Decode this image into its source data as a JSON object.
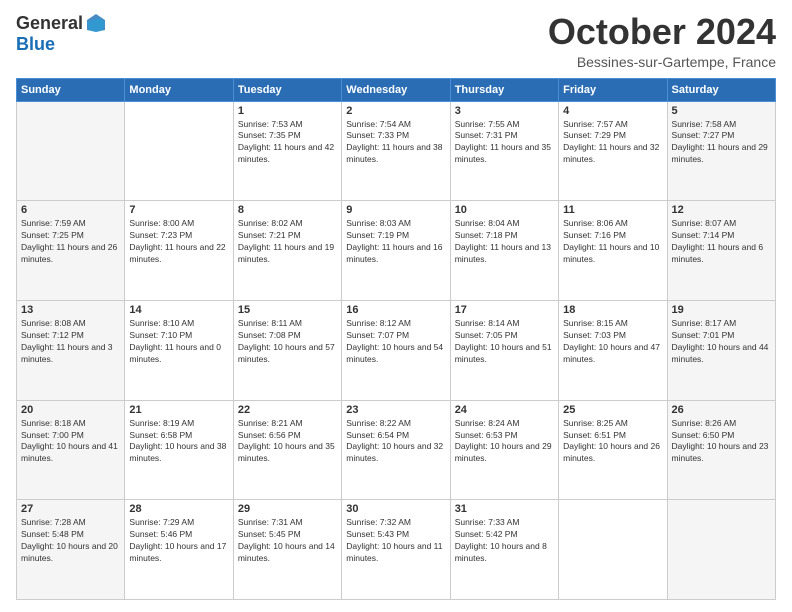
{
  "header": {
    "logo_general": "General",
    "logo_blue": "Blue",
    "month": "October 2024",
    "location": "Bessines-sur-Gartempe, France"
  },
  "weekdays": [
    "Sunday",
    "Monday",
    "Tuesday",
    "Wednesday",
    "Thursday",
    "Friday",
    "Saturday"
  ],
  "weeks": [
    [
      {
        "day": "",
        "info": ""
      },
      {
        "day": "",
        "info": ""
      },
      {
        "day": "1",
        "info": "Sunrise: 7:53 AM\nSunset: 7:35 PM\nDaylight: 11 hours and 42 minutes."
      },
      {
        "day": "2",
        "info": "Sunrise: 7:54 AM\nSunset: 7:33 PM\nDaylight: 11 hours and 38 minutes."
      },
      {
        "day": "3",
        "info": "Sunrise: 7:55 AM\nSunset: 7:31 PM\nDaylight: 11 hours and 35 minutes."
      },
      {
        "day": "4",
        "info": "Sunrise: 7:57 AM\nSunset: 7:29 PM\nDaylight: 11 hours and 32 minutes."
      },
      {
        "day": "5",
        "info": "Sunrise: 7:58 AM\nSunset: 7:27 PM\nDaylight: 11 hours and 29 minutes."
      }
    ],
    [
      {
        "day": "6",
        "info": "Sunrise: 7:59 AM\nSunset: 7:25 PM\nDaylight: 11 hours and 26 minutes."
      },
      {
        "day": "7",
        "info": "Sunrise: 8:00 AM\nSunset: 7:23 PM\nDaylight: 11 hours and 22 minutes."
      },
      {
        "day": "8",
        "info": "Sunrise: 8:02 AM\nSunset: 7:21 PM\nDaylight: 11 hours and 19 minutes."
      },
      {
        "day": "9",
        "info": "Sunrise: 8:03 AM\nSunset: 7:19 PM\nDaylight: 11 hours and 16 minutes."
      },
      {
        "day": "10",
        "info": "Sunrise: 8:04 AM\nSunset: 7:18 PM\nDaylight: 11 hours and 13 minutes."
      },
      {
        "day": "11",
        "info": "Sunrise: 8:06 AM\nSunset: 7:16 PM\nDaylight: 11 hours and 10 minutes."
      },
      {
        "day": "12",
        "info": "Sunrise: 8:07 AM\nSunset: 7:14 PM\nDaylight: 11 hours and 6 minutes."
      }
    ],
    [
      {
        "day": "13",
        "info": "Sunrise: 8:08 AM\nSunset: 7:12 PM\nDaylight: 11 hours and 3 minutes."
      },
      {
        "day": "14",
        "info": "Sunrise: 8:10 AM\nSunset: 7:10 PM\nDaylight: 11 hours and 0 minutes."
      },
      {
        "day": "15",
        "info": "Sunrise: 8:11 AM\nSunset: 7:08 PM\nDaylight: 10 hours and 57 minutes."
      },
      {
        "day": "16",
        "info": "Sunrise: 8:12 AM\nSunset: 7:07 PM\nDaylight: 10 hours and 54 minutes."
      },
      {
        "day": "17",
        "info": "Sunrise: 8:14 AM\nSunset: 7:05 PM\nDaylight: 10 hours and 51 minutes."
      },
      {
        "day": "18",
        "info": "Sunrise: 8:15 AM\nSunset: 7:03 PM\nDaylight: 10 hours and 47 minutes."
      },
      {
        "day": "19",
        "info": "Sunrise: 8:17 AM\nSunset: 7:01 PM\nDaylight: 10 hours and 44 minutes."
      }
    ],
    [
      {
        "day": "20",
        "info": "Sunrise: 8:18 AM\nSunset: 7:00 PM\nDaylight: 10 hours and 41 minutes."
      },
      {
        "day": "21",
        "info": "Sunrise: 8:19 AM\nSunset: 6:58 PM\nDaylight: 10 hours and 38 minutes."
      },
      {
        "day": "22",
        "info": "Sunrise: 8:21 AM\nSunset: 6:56 PM\nDaylight: 10 hours and 35 minutes."
      },
      {
        "day": "23",
        "info": "Sunrise: 8:22 AM\nSunset: 6:54 PM\nDaylight: 10 hours and 32 minutes."
      },
      {
        "day": "24",
        "info": "Sunrise: 8:24 AM\nSunset: 6:53 PM\nDaylight: 10 hours and 29 minutes."
      },
      {
        "day": "25",
        "info": "Sunrise: 8:25 AM\nSunset: 6:51 PM\nDaylight: 10 hours and 26 minutes."
      },
      {
        "day": "26",
        "info": "Sunrise: 8:26 AM\nSunset: 6:50 PM\nDaylight: 10 hours and 23 minutes."
      }
    ],
    [
      {
        "day": "27",
        "info": "Sunrise: 7:28 AM\nSunset: 5:48 PM\nDaylight: 10 hours and 20 minutes."
      },
      {
        "day": "28",
        "info": "Sunrise: 7:29 AM\nSunset: 5:46 PM\nDaylight: 10 hours and 17 minutes."
      },
      {
        "day": "29",
        "info": "Sunrise: 7:31 AM\nSunset: 5:45 PM\nDaylight: 10 hours and 14 minutes."
      },
      {
        "day": "30",
        "info": "Sunrise: 7:32 AM\nSunset: 5:43 PM\nDaylight: 10 hours and 11 minutes."
      },
      {
        "day": "31",
        "info": "Sunrise: 7:33 AM\nSunset: 5:42 PM\nDaylight: 10 hours and 8 minutes."
      },
      {
        "day": "",
        "info": ""
      },
      {
        "day": "",
        "info": ""
      }
    ]
  ]
}
